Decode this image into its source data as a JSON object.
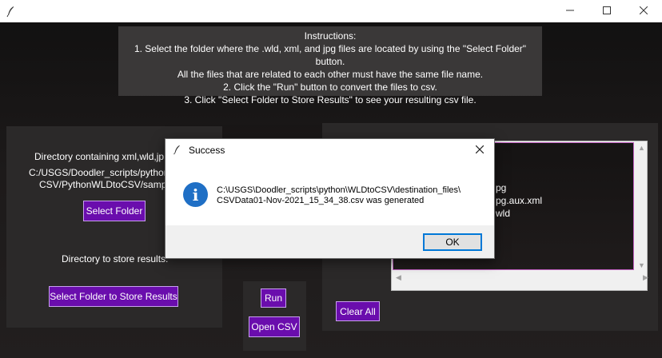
{
  "window": {
    "icons": {
      "app": "feather-icon",
      "minimize": "minimize-icon",
      "maximize": "maximize-icon",
      "close": "close-icon"
    }
  },
  "instructions": {
    "lines": [
      "Instructions:",
      "1. Select the folder where the .wld, xml, and jpg files are located by using the \"Select Folder\" button.",
      "All the files that are related to each other must have the same file name.",
      "2. Click the \"Run\" button to convert the files to csv.",
      "3. Click \"Select Folder to Store Results\" to see your resulting csv file."
    ]
  },
  "left_panel": {
    "dir_label": "Directory containing xml,wld,jp",
    "dir_path_line1": "C:/USGS/Doodler_scripts/pythor",
    "dir_path_line2": "CSV/PythonWLDtoCSV/sampl",
    "select_folder": "Select Folder",
    "store_label": "Directory to store results:",
    "select_store": "Select Folder to Store Results"
  },
  "mid_panel": {
    "run": "Run",
    "open_csv": "Open CSV"
  },
  "right_panel": {
    "files": [
      "pg",
      "pg.aux.xml",
      "wld"
    ],
    "clear_all": "Clear All"
  },
  "dialog": {
    "title": "Success",
    "message_line1": "C:\\USGS\\Doodler_scripts\\python\\WLDtoCSV\\destination_files\\",
    "message_line2": "CSVData01-Nov-2021_15_34_38.csv was generated",
    "ok": "OK",
    "icon": "info-icon"
  },
  "colors": {
    "accent_purple": "#6a0dad",
    "dialog_focus": "#0078d7",
    "info_blue": "#1f6fc5"
  }
}
